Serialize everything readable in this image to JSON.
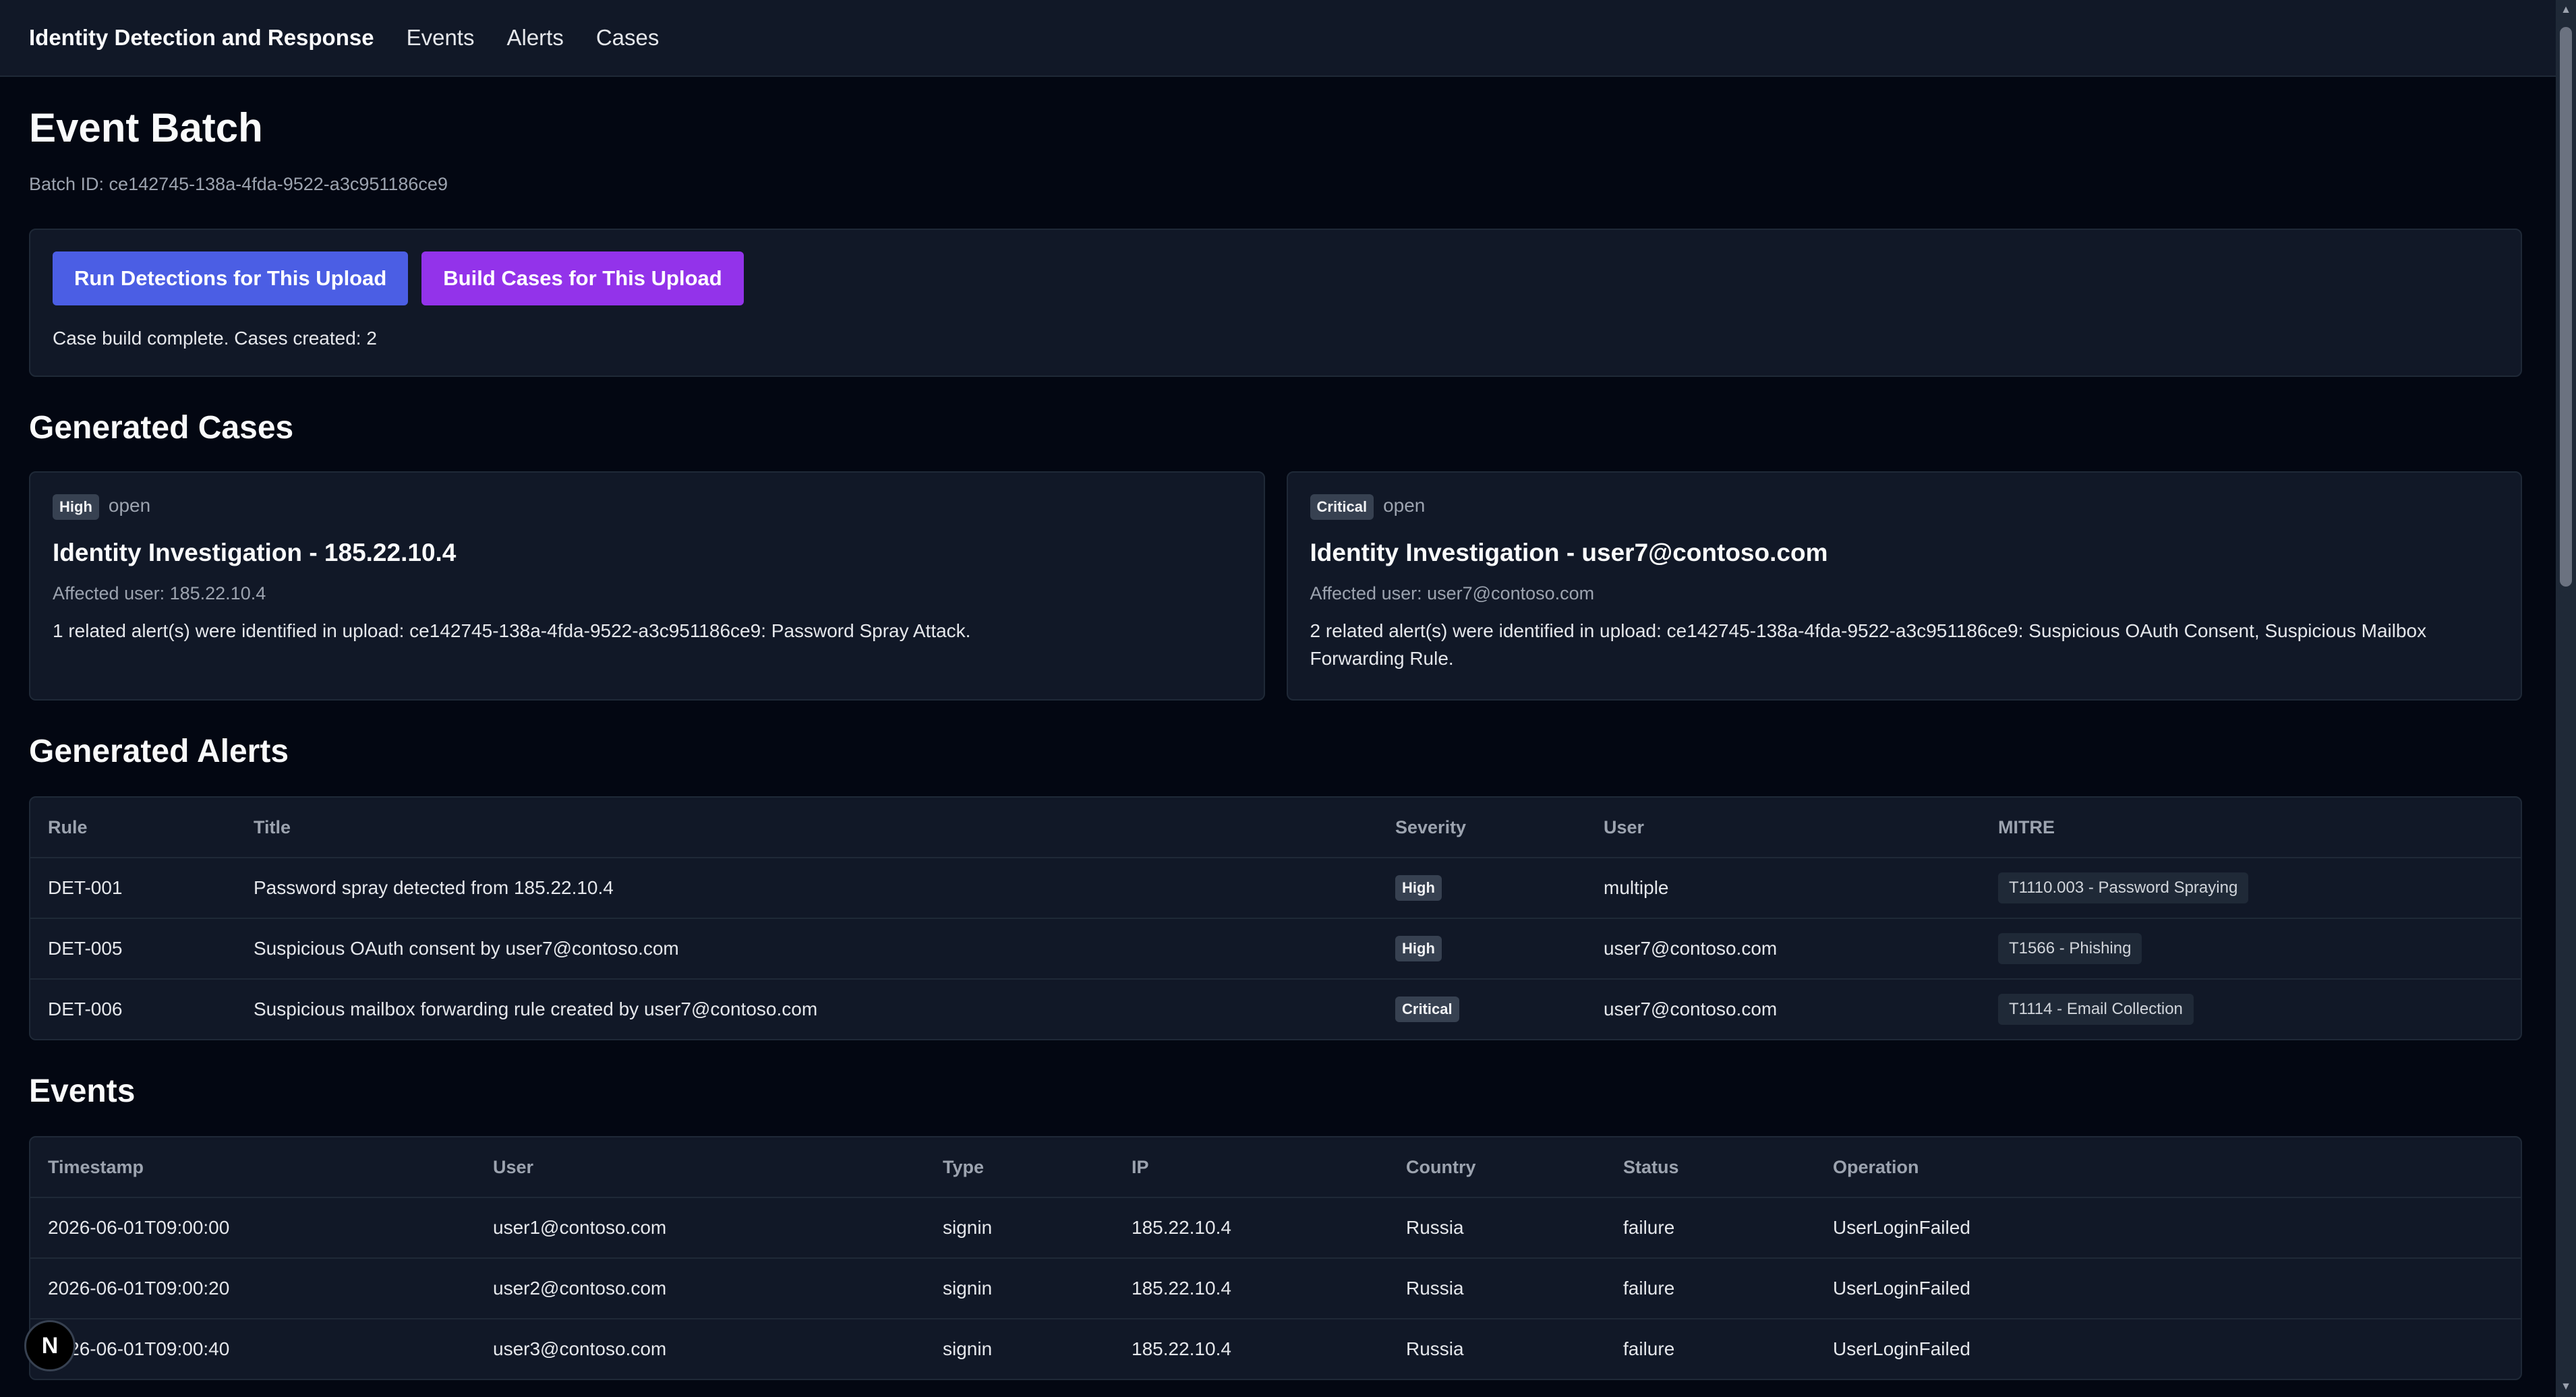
{
  "nav": {
    "brand": "Identity Detection and Response",
    "links": [
      "Events",
      "Alerts",
      "Cases"
    ]
  },
  "page": {
    "title": "Event Batch",
    "batch_label": "Batch ID: ce142745-138a-4fda-9522-a3c951186ce9"
  },
  "actions": {
    "run_detections": "Run Detections for This Upload",
    "build_cases": "Build Cases for This Upload",
    "status": "Case build complete. Cases created: 2"
  },
  "cases": {
    "heading": "Generated Cases",
    "items": [
      {
        "severity": "High",
        "status": "open",
        "title": "Identity Investigation - 185.22.10.4",
        "affected": "Affected user: 185.22.10.4",
        "description": "1 related alert(s) were identified in upload: ce142745-138a-4fda-9522-a3c951186ce9: Password Spray Attack."
      },
      {
        "severity": "Critical",
        "status": "open",
        "title": "Identity Investigation - user7@contoso.com",
        "affected": "Affected user: user7@contoso.com",
        "description": "2 related alert(s) were identified in upload: ce142745-138a-4fda-9522-a3c951186ce9: Suspicious OAuth Consent, Suspicious Mailbox Forwarding Rule."
      }
    ]
  },
  "alerts": {
    "heading": "Generated Alerts",
    "columns": [
      "Rule",
      "Title",
      "Severity",
      "User",
      "MITRE"
    ],
    "rows": [
      {
        "rule": "DET-001",
        "title": "Password spray detected from 185.22.10.4",
        "severity": "High",
        "user": "multiple",
        "mitre": "T1110.003 - Password Spraying"
      },
      {
        "rule": "DET-005",
        "title": "Suspicious OAuth consent by user7@contoso.com",
        "severity": "High",
        "user": "user7@contoso.com",
        "mitre": "T1566 - Phishing"
      },
      {
        "rule": "DET-006",
        "title": "Suspicious mailbox forwarding rule created by user7@contoso.com",
        "severity": "Critical",
        "user": "user7@contoso.com",
        "mitre": "T1114 - Email Collection"
      }
    ]
  },
  "events": {
    "heading": "Events",
    "columns": [
      "Timestamp",
      "User",
      "Type",
      "IP",
      "Country",
      "Status",
      "Operation"
    ],
    "rows": [
      {
        "timestamp": "2026-06-01T09:00:00",
        "user": "user1@contoso.com",
        "type": "signin",
        "ip": "185.22.10.4",
        "country": "Russia",
        "status": "failure",
        "operation": "UserLoginFailed"
      },
      {
        "timestamp": "2026-06-01T09:00:20",
        "user": "user2@contoso.com",
        "type": "signin",
        "ip": "185.22.10.4",
        "country": "Russia",
        "status": "failure",
        "operation": "UserLoginFailed"
      },
      {
        "timestamp": "2026-06-01T09:00:40",
        "user": "user3@contoso.com",
        "type": "signin",
        "ip": "185.22.10.4",
        "country": "Russia",
        "status": "failure",
        "operation": "UserLoginFailed"
      }
    ]
  },
  "misc": {
    "dev_badge": "N"
  }
}
